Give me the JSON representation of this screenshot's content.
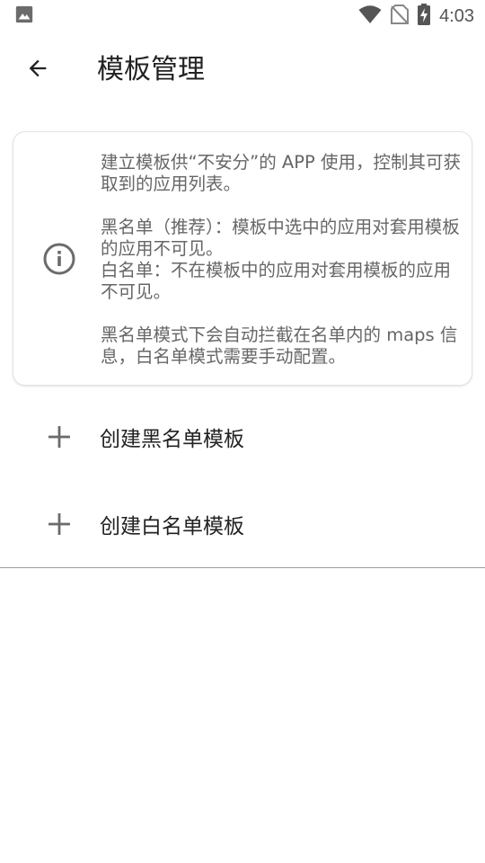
{
  "status_bar": {
    "time": "4:03",
    "icons": [
      "image-notification-icon",
      "wifi-icon",
      "no-sim-icon",
      "battery-charging-icon"
    ]
  },
  "app_bar": {
    "back_icon": "arrow-back-icon",
    "title": "模板管理"
  },
  "info_card": {
    "icon": "info-icon",
    "paragraph_1": "建立模板供“不安分”的 APP 使用，控制其可获取到的应用列表。",
    "paragraph_2": "黑名单（推荐）：模板中选中的应用对套用模板的应用不可见。",
    "paragraph_3": "白名单：不在模板中的应用对套用模板的应用不可见。",
    "paragraph_4": "黑名单模式下会自动拦截在名单内的 maps 信息，白名单模式需要手动配置。"
  },
  "actions": [
    {
      "icon": "plus-icon",
      "label": "创建黑名单模板"
    },
    {
      "icon": "plus-icon",
      "label": "创建白名单模板"
    }
  ],
  "colors": {
    "background": "#ffffff",
    "text_primary": "#222222",
    "text_secondary": "#666666",
    "icon": "#6b6b6b",
    "divider": "#9e9e9e"
  }
}
